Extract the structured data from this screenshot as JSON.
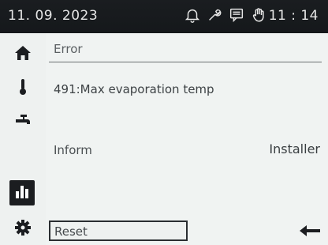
{
  "status_bar": {
    "date": "11. 09. 2023",
    "time": "11 : 14",
    "icons": [
      "bell-icon",
      "wrench-icon",
      "message-icon",
      "hand-icon"
    ]
  },
  "sidebar": {
    "items": [
      {
        "icon": "home-icon"
      },
      {
        "icon": "thermometer-icon"
      },
      {
        "icon": "faucet-icon"
      },
      {
        "icon": "bar-chart-icon",
        "active": true
      },
      {
        "icon": "gear-icon"
      }
    ]
  },
  "main": {
    "section_title": "Error",
    "error_message": "491:Max evaporation temp",
    "inform_label": "Inform",
    "inform_value": "Installer"
  },
  "footer": {
    "reset_label": "Reset",
    "back_icon": "back-arrow-icon"
  },
  "colors": {
    "status_bar_bg": "#16191c",
    "screen_bg": "#f0f3f2",
    "active_item_bg": "#1b1d20"
  }
}
